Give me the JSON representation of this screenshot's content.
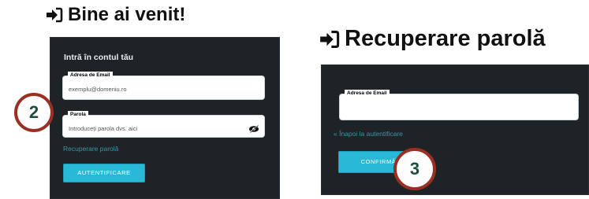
{
  "left": {
    "heading": "Bine ai venit!",
    "panel_title": "Intră în contul tău",
    "email_label": "Adresa de Email",
    "email_placeholder": "exemplu@domeniu.ro",
    "password_label": "Parola",
    "password_placeholder": "Introduceți parola dvs. aici",
    "recover_link": "Recuperare parolă",
    "login_button": "AUTENTIFICARE",
    "step_marker": "2"
  },
  "right": {
    "heading": "Recuperare parolă",
    "email_label": "Adresa de Email",
    "email_placeholder": "",
    "back_link": "« Înapoi la autentificare",
    "confirm_button": "CONFIRMĂ",
    "step_marker": "3"
  },
  "icons": {
    "heading_icon": "sign-in-icon",
    "eye_icon": "eye-slash-icon"
  },
  "colors": {
    "panel_bg": "#1e2326",
    "accent": "#29b8d5",
    "link": "#3f94a6",
    "step_border": "#9a3024",
    "step_text": "#1f4d3b"
  }
}
